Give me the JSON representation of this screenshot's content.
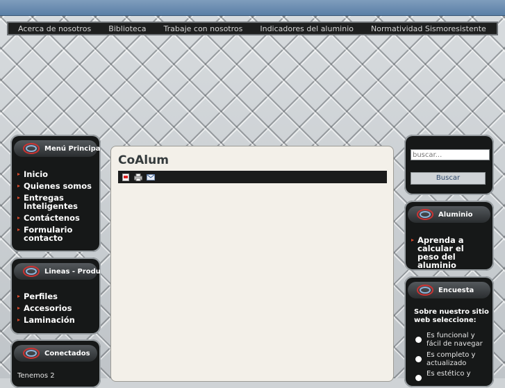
{
  "nav": {
    "items": [
      "Acerca de nosotros",
      "Biblioteca",
      "Trabaje con nosotros",
      "Indicadores del aluminio",
      "Normatividad Sismoresistente"
    ]
  },
  "menu_principal": {
    "title": "Menú Principal",
    "items": [
      "Inicio",
      "Quienes somos",
      "Entregas Inteligentes",
      "Contáctenos",
      "Formulario contacto"
    ]
  },
  "lineas": {
    "title": "Lineas - Productos",
    "items": [
      "Perfiles",
      "Accesorios",
      "Laminación"
    ]
  },
  "conectados": {
    "title": "Conectados",
    "text": "Tenemos 2"
  },
  "content": {
    "title": "CoAlum",
    "toolbar_icons": [
      "pdf-icon",
      "print-icon",
      "email-icon"
    ]
  },
  "search": {
    "placeholder": "buscar...",
    "button_label": "Buscar"
  },
  "aluminio": {
    "title": "Aluminio",
    "items": [
      "Aprenda a calcular el peso del aluminio"
    ]
  },
  "encuesta": {
    "title": "Encuesta",
    "question": "Sobre nuestro sitio web seleccione:",
    "options": [
      "Es funcional y fácil de navegar",
      "Es completo y actualizado",
      "Es estético y"
    ]
  },
  "colors": {
    "bullet": "#d94a2c",
    "navbar": "#1e1f1f",
    "content_bg": "#f3f0e9"
  }
}
